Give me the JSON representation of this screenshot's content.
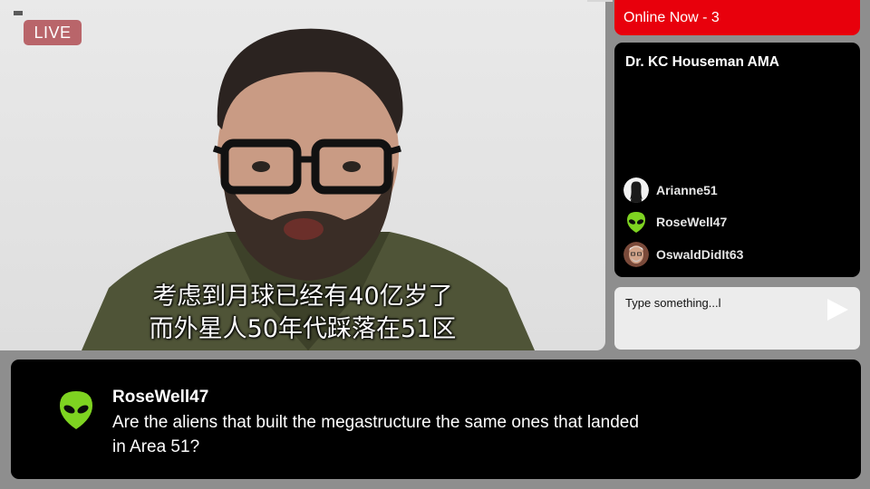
{
  "video": {
    "live_label": "LIVE",
    "subtitle_line1": "考虑到月球已经有40亿岁了",
    "subtitle_line2": "而外星人50年代踩落在51区"
  },
  "sidebar": {
    "online_label": "Online Now - 3",
    "panel_title": "Dr. KC Houseman AMA",
    "users": [
      {
        "name": "Arianne51",
        "avatar": "person-silhouette-icon"
      },
      {
        "name": "RoseWell47",
        "avatar": "alien-icon"
      },
      {
        "name": "OswaldDidIt63",
        "avatar": "photo-avatar"
      }
    ],
    "input_placeholder": "Type something...l",
    "send_icon": "play-triangle-icon"
  },
  "message": {
    "author": "RoseWell47",
    "avatar": "alien-icon",
    "text": "Are the aliens that built the megastructure the same ones that landed in Area 51?"
  },
  "colors": {
    "live_badge": "#b9656a",
    "online_bar": "#e8000c",
    "alien_green": "#7ed321",
    "panel_bg": "#000000"
  }
}
